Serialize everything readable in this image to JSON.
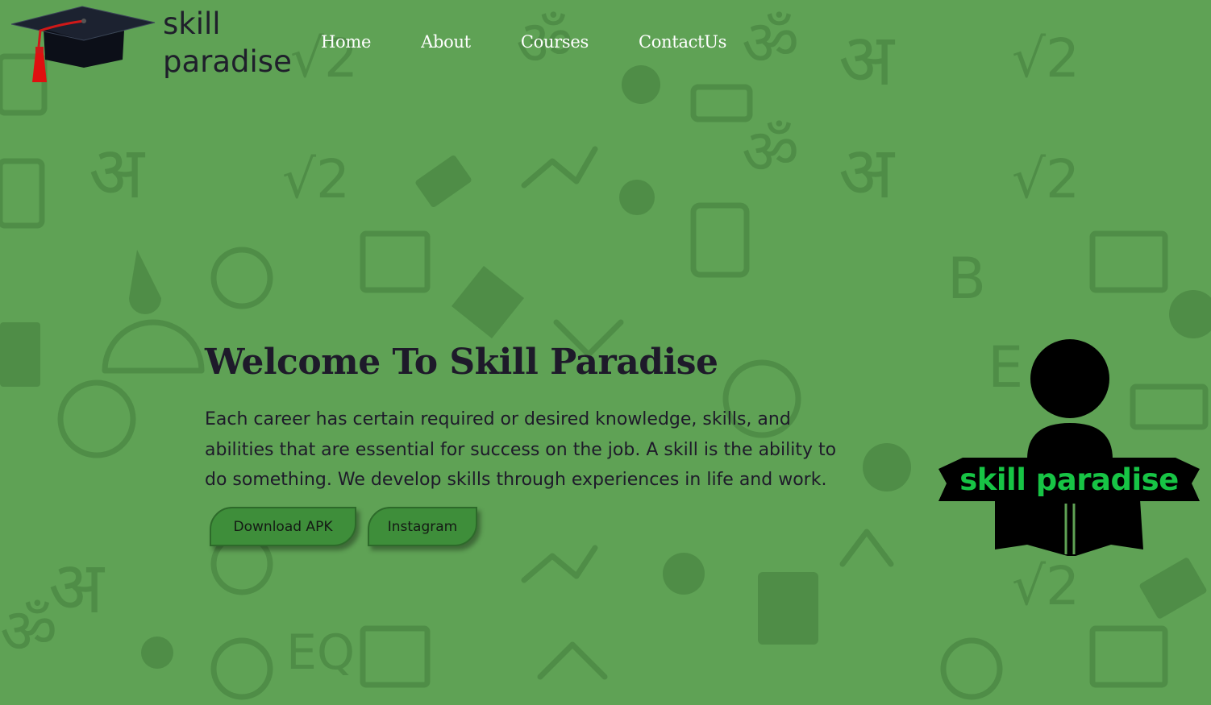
{
  "brand": {
    "line1": "skill",
    "line2": "paradise"
  },
  "nav": {
    "items": [
      "Home",
      "About",
      "Courses",
      "ContactUs"
    ]
  },
  "hero": {
    "title": "Welcome To Skill Paradise",
    "description": "Each career has certain required or desired knowledge, skills, and abilities that are essential for success on the job. A skill is the ability to do something. We develop skills through experiences in life and work."
  },
  "buttons": {
    "download_label": "Download APK",
    "instagram_label": "Instagram"
  },
  "illustration": {
    "label": "skill paradise"
  },
  "colors": {
    "background": "#5fa255",
    "pattern": "#4d8a45",
    "button": "#3e8e3a",
    "illustration_text": "#17c445"
  }
}
